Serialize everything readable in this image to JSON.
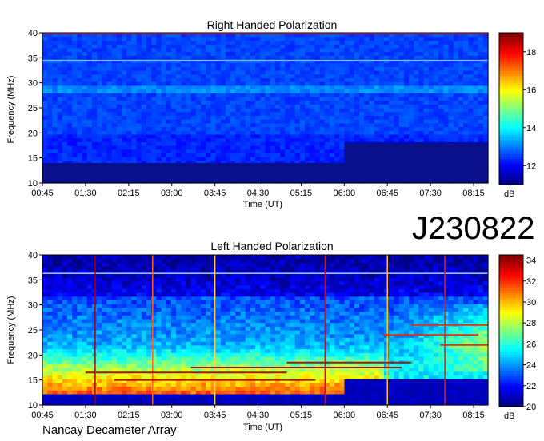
{
  "chart_data": [
    {
      "type": "heatmap",
      "title": "Right Handed Polarization",
      "xlabel": "Time (UT)",
      "ylabel": "Frequency (MHz)",
      "x_ticks": [
        "00:45",
        "01:30",
        "02:15",
        "03:00",
        "03:45",
        "04:30",
        "05:15",
        "06:00",
        "06:45",
        "07:30",
        "08:15"
      ],
      "y_ticks": [
        10,
        15,
        20,
        25,
        30,
        35,
        40
      ],
      "ylim": [
        10,
        40
      ],
      "colorbar": {
        "label": "dB",
        "ticks": [
          12,
          14,
          16,
          18
        ],
        "range": [
          11,
          19
        ]
      },
      "features": [
        {
          "kind": "low-band-floor",
          "max_freq_mhz": 14,
          "time_range": [
            "00:45",
            "06:00"
          ]
        },
        {
          "kind": "low-band-floor",
          "max_freq_mhz": 18,
          "time_range": [
            "06:00",
            "08:30"
          ]
        },
        {
          "kind": "horizontal-line",
          "freq_mhz": 34.5
        },
        {
          "kind": "horizontal-line",
          "freq_mhz": 39.8
        }
      ]
    },
    {
      "type": "heatmap",
      "title": "Left Handed Polarization",
      "xlabel": "Time (UT)",
      "ylabel": "Frequency (MHz)",
      "x_ticks": [
        "00:45",
        "01:30",
        "02:15",
        "03:00",
        "03:45",
        "04:30",
        "05:15",
        "06:00",
        "06:45",
        "07:30",
        "08:15"
      ],
      "y_ticks": [
        10,
        15,
        20,
        25,
        30,
        35,
        40
      ],
      "ylim": [
        10,
        40
      ],
      "colorbar": {
        "label": "dB",
        "ticks": [
          20,
          22,
          24,
          26,
          28,
          30,
          32,
          34
        ],
        "range": [
          20,
          34.5
        ]
      },
      "features": [
        {
          "kind": "horizontal-line",
          "freq_mhz": 36.3
        },
        {
          "kind": "vertical-spike",
          "time": "01:40"
        },
        {
          "kind": "vertical-spike",
          "time": "02:40"
        },
        {
          "kind": "vertical-spike",
          "time": "03:45"
        },
        {
          "kind": "vertical-spike",
          "time": "05:40"
        },
        {
          "kind": "vertical-spike",
          "time": "06:45"
        },
        {
          "kind": "vertical-spike",
          "time": "07:45"
        }
      ]
    }
  ],
  "header_label": "J230822",
  "footer_label": "Nancay Decameter Array"
}
